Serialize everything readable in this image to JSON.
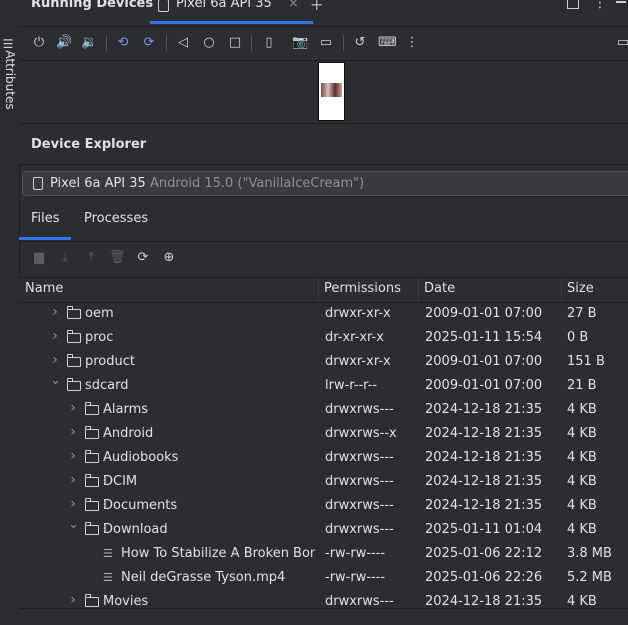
{
  "side": {
    "attributes_label": "Attributes"
  },
  "header": {
    "title": "Running Devices",
    "tab_label": "Pixel 6a API 35",
    "tab_close": "×",
    "add_tab": "+"
  },
  "toolbar": {
    "icons": [
      "power-icon",
      "volume-up-icon",
      "volume-down-icon",
      "rotate-left-icon",
      "rotate-right-icon",
      "back-icon",
      "home-icon",
      "overview-icon",
      "device-state-icon",
      "screenshot-icon",
      "screen-record-icon",
      "reset-icon",
      "keyboard-icon",
      "more-icon"
    ]
  },
  "explorer": {
    "title": "Device Explorer",
    "device_name": "Pixel 6a API 35",
    "device_os": "Android 15.0 (\"VanillaIceCream\")",
    "tabs": [
      "Files",
      "Processes"
    ],
    "columns": [
      "Name",
      "Permissions",
      "Date",
      "Size"
    ],
    "rows": [
      {
        "name": "oem",
        "perm": "drwxr-xr-x",
        "date": "2009-01-01 07:00",
        "size": "27 B",
        "type": "folder",
        "depth": 0,
        "state": "collapsed"
      },
      {
        "name": "proc",
        "perm": "dr-xr-xr-x",
        "date": "2025-01-11 15:54",
        "size": "0 B",
        "type": "folder",
        "depth": 0,
        "state": "collapsed"
      },
      {
        "name": "product",
        "perm": "drwxr-xr-x",
        "date": "2009-01-01 07:00",
        "size": "151 B",
        "type": "folder",
        "depth": 0,
        "state": "collapsed"
      },
      {
        "name": "sdcard",
        "perm": "lrw-r--r--",
        "date": "2009-01-01 07:00",
        "size": "21 B",
        "type": "link-folder",
        "depth": 0,
        "state": "expanded"
      },
      {
        "name": "Alarms",
        "perm": "drwxrws---",
        "date": "2024-12-18 21:35",
        "size": "4 KB",
        "type": "folder",
        "depth": 1,
        "state": "collapsed"
      },
      {
        "name": "Android",
        "perm": "drwxrws--x",
        "date": "2024-12-18 21:35",
        "size": "4 KB",
        "type": "folder",
        "depth": 1,
        "state": "collapsed"
      },
      {
        "name": "Audiobooks",
        "perm": "drwxrws---",
        "date": "2024-12-18 21:35",
        "size": "4 KB",
        "type": "folder",
        "depth": 1,
        "state": "collapsed"
      },
      {
        "name": "DCIM",
        "perm": "drwxrws---",
        "date": "2024-12-18 21:35",
        "size": "4 KB",
        "type": "folder",
        "depth": 1,
        "state": "collapsed"
      },
      {
        "name": "Documents",
        "perm": "drwxrws---",
        "date": "2024-12-18 21:35",
        "size": "4 KB",
        "type": "folder",
        "depth": 1,
        "state": "collapsed"
      },
      {
        "name": "Download",
        "perm": "drwxrws---",
        "date": "2025-01-11 01:04",
        "size": "4 KB",
        "type": "folder",
        "depth": 1,
        "state": "expanded"
      },
      {
        "name": "How To Stabilize A Broken Bone",
        "perm": "-rw-rw----",
        "date": "2025-01-06 22:12",
        "size": "3.8 MB",
        "type": "file",
        "depth": 2,
        "state": "none"
      },
      {
        "name": "Neil deGrasse Tyson.mp4",
        "perm": "-rw-rw----",
        "date": "2025-01-06 22:26",
        "size": "5.2 MB",
        "type": "file",
        "depth": 2,
        "state": "none"
      },
      {
        "name": "Movies",
        "perm": "drwxrws---",
        "date": "2024-12-18 21:35",
        "size": "4 KB",
        "type": "folder",
        "depth": 1,
        "state": "collapsed"
      }
    ]
  },
  "colors": {
    "accent": "#3574f0",
    "background": "#2b2d30",
    "text": "#dfe1e5"
  }
}
